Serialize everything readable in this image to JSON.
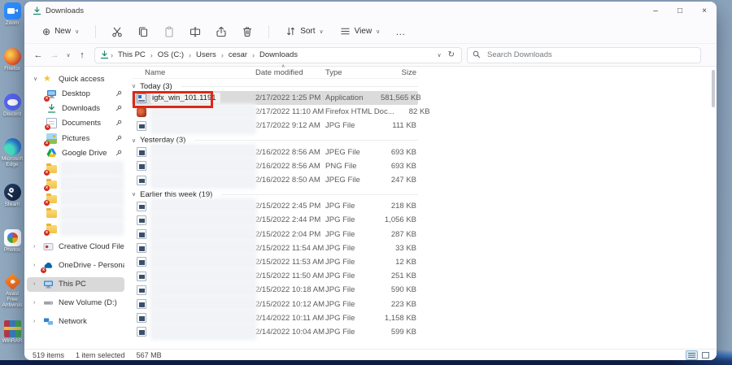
{
  "desktop": {
    "icons": [
      {
        "label": "Zoom"
      },
      {
        "label": "Firefox"
      },
      {
        "label": "Discord"
      },
      {
        "label": "Microsoft Edge"
      },
      {
        "label": "Steam"
      },
      {
        "label": "Photos"
      },
      {
        "label": "Avast Free Antivirus"
      },
      {
        "label": "WinRAR"
      }
    ]
  },
  "glyphs": {
    "back": "←",
    "forward": "→",
    "up": "↑",
    "refresh": "↻",
    "dropdown": "∨",
    "crumb_sep": "›",
    "expand": "∨",
    "collapse": "›",
    "more": "…",
    "new_plus": "⊕",
    "minimize": "–",
    "maximize": "□",
    "close": "×",
    "sort_caret": "∧"
  },
  "window": {
    "tab_title": "Downloads",
    "toolbar": {
      "new": "New",
      "sort": "Sort",
      "view": "View"
    },
    "address": {
      "crumbs": [
        "This PC",
        "OS (C:)",
        "Users",
        "cesar",
        "Downloads"
      ],
      "search_placeholder": "Search Downloads"
    }
  },
  "sidebar": {
    "quick_access": "Quick access",
    "pinned": [
      {
        "label": "Desktop"
      },
      {
        "label": "Downloads"
      },
      {
        "label": "Documents"
      },
      {
        "label": "Pictures"
      },
      {
        "label": "Google Drive"
      }
    ],
    "roots": [
      {
        "label": "Creative Cloud Files"
      },
      {
        "label": "OneDrive - Personal"
      },
      {
        "label": "This PC"
      },
      {
        "label": "New Volume (D:)"
      },
      {
        "label": "Network"
      }
    ]
  },
  "files": {
    "columns": [
      "Name",
      "Date modified",
      "Type",
      "Size"
    ],
    "groups": [
      {
        "label": "Today (3)",
        "rows": [
          {
            "name": "igfx_win_101.1191",
            "date": "2/17/2022 1:25 PM",
            "type": "Application",
            "size": "581,565 KB"
          },
          {
            "date": "2/17/2022 11:10 AM",
            "type": "Firefox HTML Doc...",
            "size": "82 KB"
          },
          {
            "date": "2/17/2022 9:12 AM",
            "type": "JPG File",
            "size": "111 KB"
          }
        ]
      },
      {
        "label": "Yesterday (3)",
        "rows": [
          {
            "date": "2/16/2022 8:56 AM",
            "type": "JPEG File",
            "size": "693 KB"
          },
          {
            "date": "2/16/2022 8:56 AM",
            "type": "PNG File",
            "size": "693 KB"
          },
          {
            "date": "2/16/2022 8:50 AM",
            "type": "JPEG File",
            "size": "247 KB"
          }
        ]
      },
      {
        "label": "Earlier this week (19)",
        "rows": [
          {
            "date": "2/15/2022 2:45 PM",
            "type": "JPG File",
            "size": "218 KB"
          },
          {
            "date": "2/15/2022 2:44 PM",
            "type": "JPG File",
            "size": "1,056 KB"
          },
          {
            "date": "2/15/2022 2:04 PM",
            "type": "JPG File",
            "size": "287 KB"
          },
          {
            "date": "2/15/2022 11:54 AM",
            "type": "JPG File",
            "size": "33 KB"
          },
          {
            "date": "2/15/2022 11:53 AM",
            "type": "JPG File",
            "size": "12 KB"
          },
          {
            "date": "2/15/2022 11:50 AM",
            "type": "JPG File",
            "size": "251 KB"
          },
          {
            "date": "2/15/2022 10:18 AM",
            "type": "JPG File",
            "size": "590 KB"
          },
          {
            "date": "2/15/2022 10:12 AM",
            "type": "JPG File",
            "size": "223 KB"
          },
          {
            "date": "2/14/2022 10:11 AM",
            "type": "JPG File",
            "size": "1,158 KB"
          },
          {
            "date": "2/14/2022 10:04 AM",
            "type": "JPG File",
            "size": "599 KB"
          }
        ]
      }
    ]
  },
  "statusbar": {
    "count": "519 items",
    "selected": "1 item selected",
    "size": "567 MB"
  },
  "colors": {
    "annotation_red": "#dd2817",
    "selection_gray": "#d9d9d9",
    "accent_blue": "#0067c0"
  }
}
